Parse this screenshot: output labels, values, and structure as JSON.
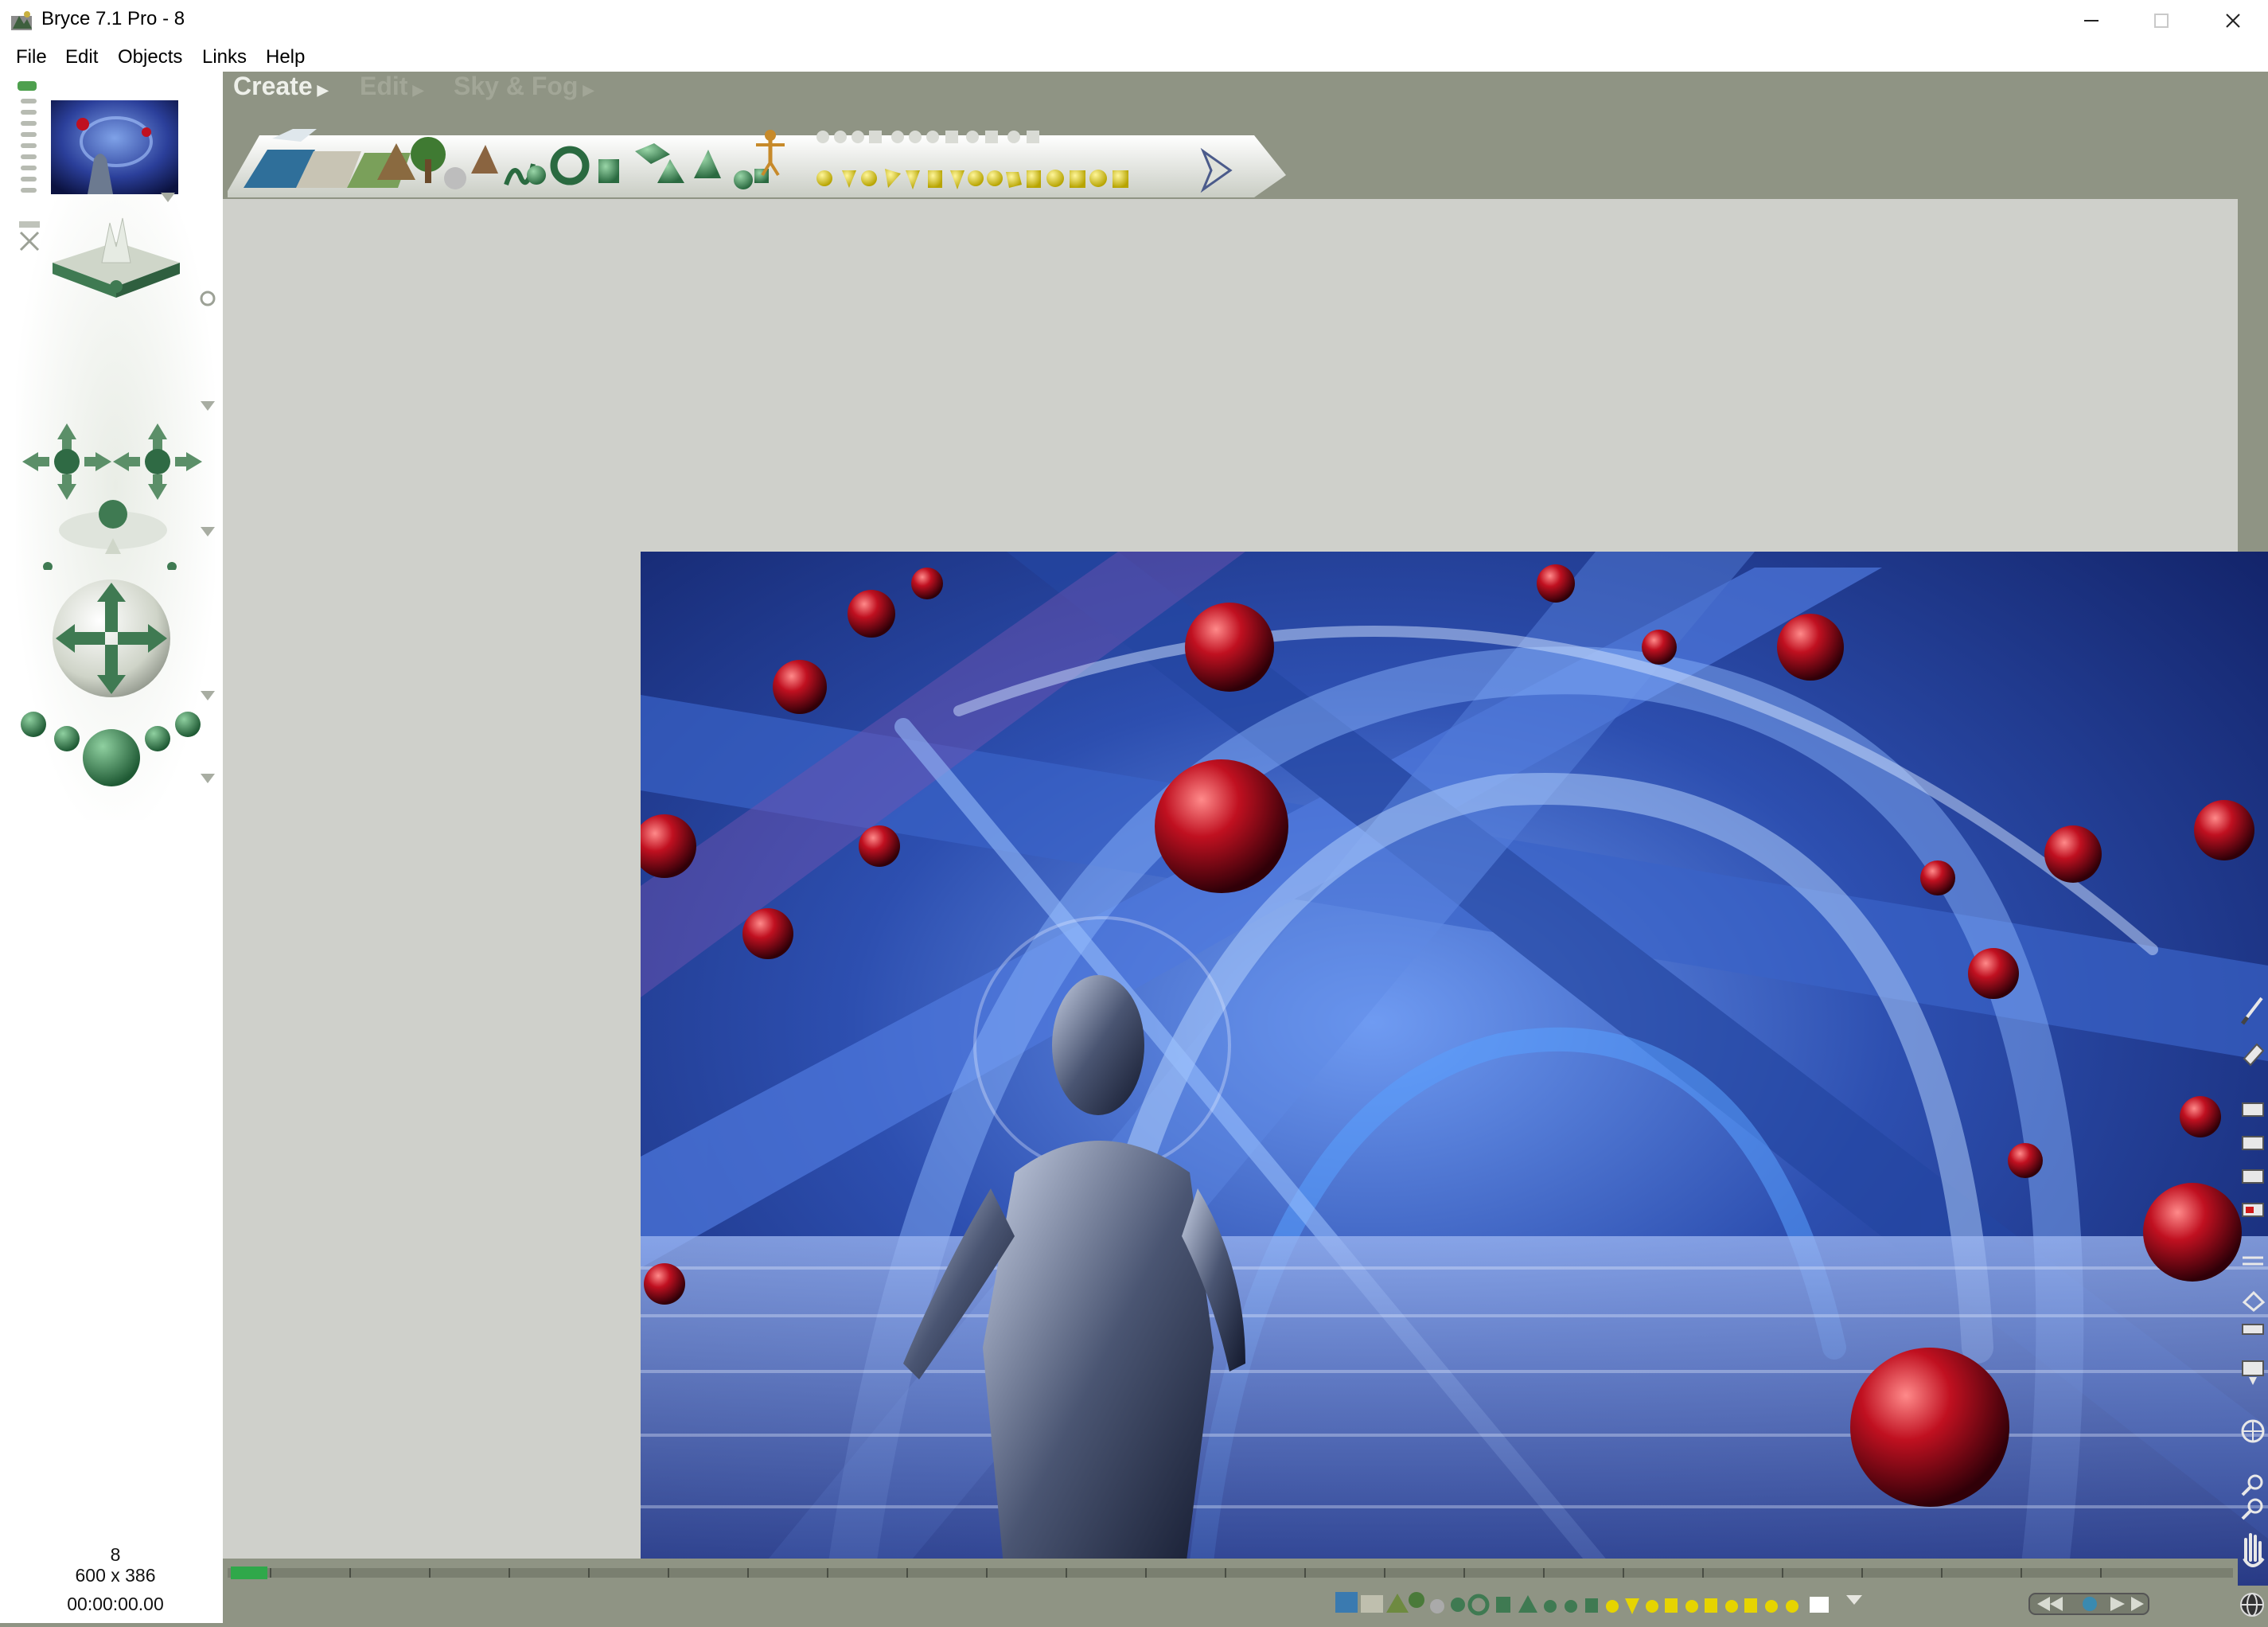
{
  "window": {
    "title": "Bryce 7.1  Pro - 8",
    "app_icon": "bryce-app-icon",
    "minimize_glyph": "—",
    "maximize_glyph": "☐",
    "close_glyph": "✕"
  },
  "menubar": {
    "items": [
      "File",
      "Edit",
      "Objects",
      "Links",
      "Help"
    ]
  },
  "modes": {
    "create": "Create",
    "edit": "Edit",
    "sky_fog": "Sky & Fog"
  },
  "status": {
    "frame": "8",
    "dimensions": "600 x 386",
    "time": "00:00:00.00"
  },
  "colors": {
    "chrome_gray": "#8f9484",
    "document_gray": "#cfd0cb",
    "palette_white": "#ffffff",
    "control_green": "#3f7a52",
    "primitive_yellow": "#e6d400",
    "render_blue": "#2c4fae",
    "sphere_red": "#c01020"
  },
  "icons": {
    "left_palette": [
      "nano-preview-icon",
      "view-cube-icon",
      "trackball-icon",
      "camera-cross-icon"
    ],
    "right_tools": [
      "brush-icon",
      "eraser-icon",
      "zoom-in-icon",
      "zoom-out-icon",
      "hand-pan-icon",
      "globe-icon"
    ],
    "playback": [
      "rewind-icon",
      "play-icon",
      "fast-forward-icon"
    ]
  }
}
